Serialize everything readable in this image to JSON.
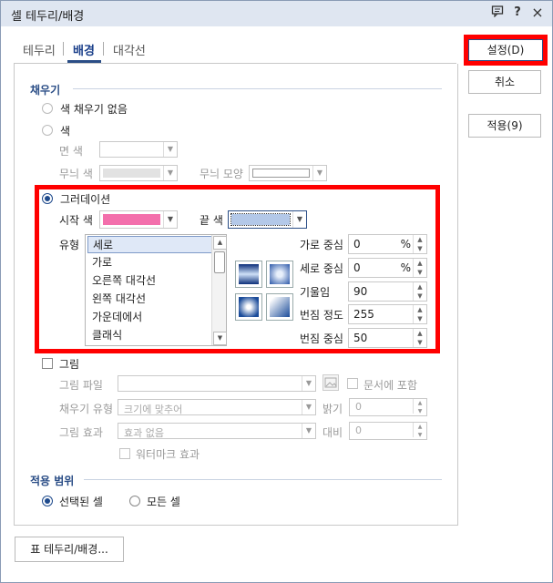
{
  "window": {
    "title": "셀 테두리/배경",
    "help_icon": "?",
    "close_icon": "×"
  },
  "tabs": [
    {
      "label": "테두리",
      "active": false
    },
    {
      "label": "배경",
      "active": true
    },
    {
      "label": "대각선",
      "active": false
    }
  ],
  "fill": {
    "section_title": "채우기",
    "no_fill_label": "색 채우기 없음",
    "color_label": "색",
    "face_color_label": "면 색",
    "pattern_color_label": "무늬 색",
    "pattern_shape_label": "무늬 모양",
    "gradient_label": "그러데이션",
    "start_color_label": "시작 색",
    "start_color": "#f36fac",
    "end_color_label": "끝 색",
    "end_color": "#b3c8e8",
    "type_label": "유형",
    "types": [
      "세로",
      "가로",
      "오른쪽 대각선",
      "왼쪽 대각선",
      "가운데에서",
      "클래식"
    ],
    "selected_type": "세로",
    "h_center_label": "가로 중심",
    "h_center_value": "0",
    "v_center_label": "세로 중심",
    "v_center_value": "0",
    "tilt_label": "기울임",
    "tilt_value": "90",
    "blur_level_label": "번짐 정도",
    "blur_level_value": "255",
    "blur_center_label": "번짐 중심",
    "blur_center_value": "50",
    "percent_unit": "%",
    "picture_label": "그림",
    "picture_file_label": "그림 파일",
    "include_in_doc_label": "문서에 포함",
    "fill_type_label": "채우기 유형",
    "fill_type_value": "크기에 맞추어",
    "brightness_label": "밝기",
    "brightness_value": "0",
    "picture_effect_label": "그림 효과",
    "picture_effect_value": "효과 없음",
    "contrast_label": "대비",
    "contrast_value": "0",
    "watermark_label": "워터마크 효과"
  },
  "scope": {
    "section_title": "적용 범위",
    "selected_cells_label": "선택된 셀",
    "all_cells_label": "모든 셀"
  },
  "buttons": {
    "ok": "설정(D)",
    "cancel": "취소",
    "apply": "적용(9)",
    "table_border": "표 테두리/배경..."
  }
}
